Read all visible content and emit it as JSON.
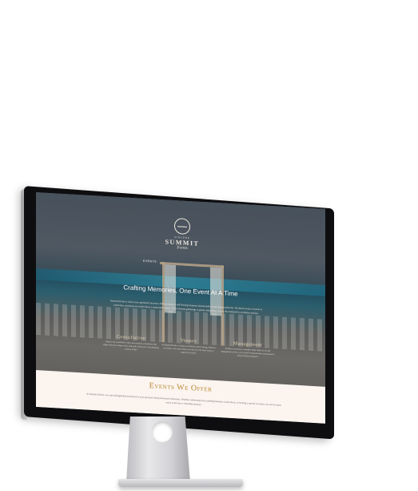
{
  "site": {
    "logo": {
      "small_text": "SINCERE",
      "main_text": "SUMMIT",
      "script_text": "Events"
    },
    "nav": {
      "label": "EVENTS"
    },
    "hero": {
      "headline": "Crafting Memories, One Event At A Time",
      "intro": "Summit Events is where your aspirations become a lifetime memory and flowing moments intentionally create lasting memories. We devote every occasion to perfection, ensuring your event leaves a memorable impact. From intimate gatherings to grand celebrations, we set the standard for excellence and joy."
    },
    "columns": [
      {
        "title": "Consultation",
        "text": "Explore the possibilities with a personalized consultation that aligns with your unique vision and goals. Start your event planning journey today!"
      },
      {
        "title": "Venues",
        "text": "At Summit Events, we help you find the perfect setting, whatever you desire. Our team ensures you discover the ideal venue to match your vision."
      },
      {
        "title": "Management",
        "text": "Seamless execution, everyday results. Rely on our full management service, every detail is meticulously orchestrated to ensure flawless moments."
      }
    ],
    "events": {
      "title": "Events We Offer",
      "text": "At Summit Events, we craft unforgettable moments for your personal and professional milestones. Whether celebrating love, building business connections, or hosting a special occasion, our service turns every event into a cherished memory."
    }
  }
}
